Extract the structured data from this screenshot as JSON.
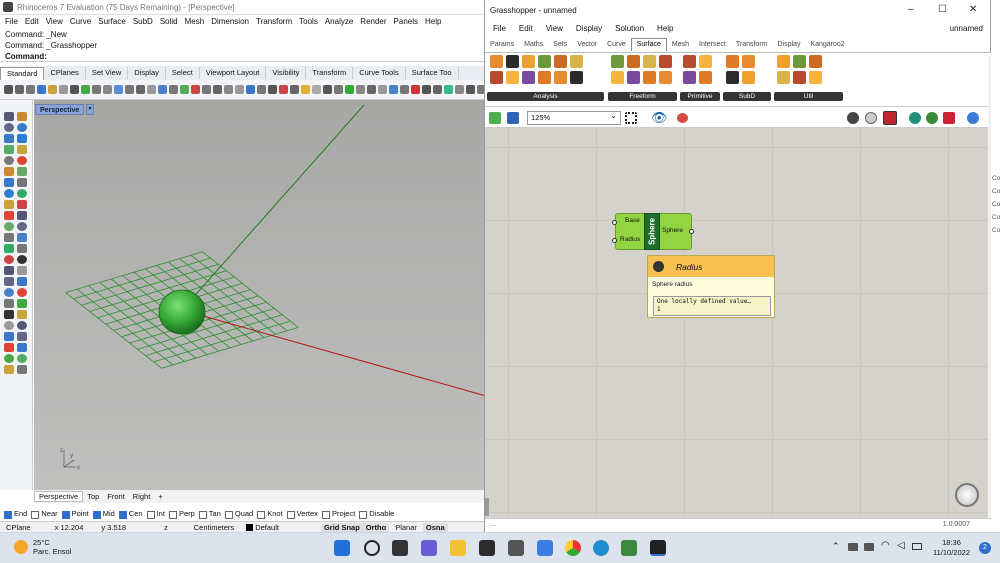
{
  "rhino": {
    "title": "Rhinoceros 7 Evaluation (75 Days Remaining) - [Perspective]",
    "menu": [
      "File",
      "Edit",
      "View",
      "Curve",
      "Surface",
      "SubD",
      "Solid",
      "Mesh",
      "Dimension",
      "Transform",
      "Tools",
      "Analyze",
      "Render",
      "Panels",
      "Help"
    ],
    "command_lines": [
      "Command: _New",
      "Command: _Grasshopper"
    ],
    "command_prompt": "Command:",
    "toolbar_tabs": [
      "Standard",
      "CPlanes",
      "Set View",
      "Display",
      "Select",
      "Viewport Layout",
      "Visibility",
      "Transform",
      "Curve Tools",
      "Surface Too"
    ],
    "viewport_label": "Perspective",
    "viewport_tabs": [
      "Perspective",
      "Top",
      "Front",
      "Right"
    ],
    "add_view": "+",
    "axis_labels": {
      "z": "z",
      "y": "y",
      "x": "x"
    },
    "osnaps": [
      {
        "label": "End",
        "checked": true
      },
      {
        "label": "Near",
        "checked": false
      },
      {
        "label": "Point",
        "checked": true
      },
      {
        "label": "Mid",
        "checked": true
      },
      {
        "label": "Cen",
        "checked": true
      },
      {
        "label": "Int",
        "checked": false
      },
      {
        "label": "Perp",
        "checked": false
      },
      {
        "label": "Tan",
        "checked": false
      },
      {
        "label": "Quad",
        "checked": false
      },
      {
        "label": "Knot",
        "checked": false
      },
      {
        "label": "Vertex",
        "checked": false
      },
      {
        "label": "Project",
        "checked": false
      },
      {
        "label": "Disable",
        "checked": false
      }
    ],
    "status": {
      "cplane": "CPlane",
      "x": "x 12.204",
      "y": "y 3.518",
      "z": "z",
      "units": "Centimeters",
      "layer": "Default",
      "grid_snap": "Grid Snap",
      "ortho": "Ortho",
      "planar": "Planar",
      "osnap": "Osna"
    }
  },
  "grasshopper": {
    "title": "Grasshopper - unnamed",
    "menu": [
      "File",
      "Edit",
      "View",
      "Display",
      "Solution",
      "Help"
    ],
    "document_name": "unnamed",
    "tabs": [
      "Params",
      "Maths",
      "Sets",
      "Vector",
      "Curve",
      "Surface",
      "Mesh",
      "Intersect",
      "Transform",
      "Display",
      "Kangaroo2"
    ],
    "active_tab": "Surface",
    "ribbon_groups": [
      "Analysis",
      "Freeform",
      "Primitive",
      "SubD",
      "Util"
    ],
    "zoom": "125%",
    "component": {
      "name": "Sphere",
      "inputs": [
        "Base",
        "Radius"
      ],
      "output": "Sphere"
    },
    "tooltip": {
      "title": "Radius",
      "description": "Sphere radius",
      "value_line1": "One locally defined value…",
      "value_line2": "1"
    },
    "status_left": "...",
    "version": "1.0.0007"
  },
  "edge_labels": [
    "Co",
    "Co",
    "Co",
    "Co",
    "Co"
  ],
  "taskbar": {
    "temperature": "25°C",
    "weather": "Parc. Ensol",
    "time": "18:36",
    "date": "11/10/2022",
    "notifications": "2"
  }
}
